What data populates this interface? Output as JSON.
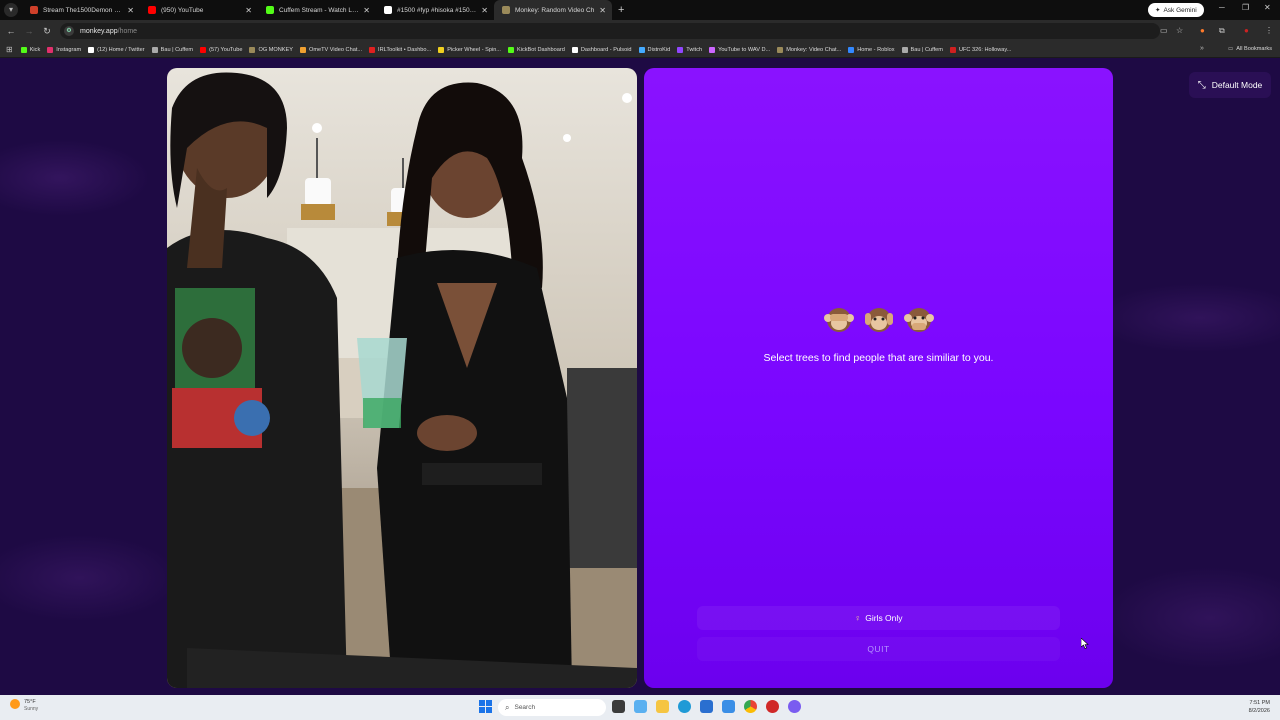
{
  "browser": {
    "tabs": [
      {
        "title": "Stream The1500Demon music",
        "fav": "#d0402a"
      },
      {
        "title": "(950) YouTube",
        "fav": "#ff0000"
      },
      {
        "title": "Cuffem Stream - Watch Live on",
        "fav": "#53fc18"
      },
      {
        "title": "#1500 #fyp #hisoka #1500dem",
        "fav": "#ffffff"
      },
      {
        "title": "Monkey: Random Video Ch",
        "fav": "#9a8a5a",
        "active": true
      }
    ],
    "new_tab": "+",
    "ask_gemini": "Ask Gemini",
    "url_host": "monkey.app",
    "url_path": "/home",
    "bookmarks": [
      {
        "label": "Kick",
        "color": "#53fc18"
      },
      {
        "label": "Instagram",
        "color": "#e1306c"
      },
      {
        "label": "(12) Home / Twitter",
        "color": "#ffffff"
      },
      {
        "label": "Bau | Cuffem",
        "color": "#aaaaaa"
      },
      {
        "label": "(57) YouTube",
        "color": "#ff0000"
      },
      {
        "label": "OG MONKEY",
        "color": "#9a8a5a"
      },
      {
        "label": "OmeTV Video Chat...",
        "color": "#f0a030"
      },
      {
        "label": "IRLToolkit • Dashbo...",
        "color": "#e02020"
      },
      {
        "label": "Picker Wheel - Spin...",
        "color": "#f0d020"
      },
      {
        "label": "KickBot Dashboard",
        "color": "#53fc18"
      },
      {
        "label": "Dashboard - Pulsoid",
        "color": "#ffffff"
      },
      {
        "label": "DistroKid",
        "color": "#44aaff"
      },
      {
        "label": "Twitch",
        "color": "#9146ff"
      },
      {
        "label": "YouTube to WAV D...",
        "color": "#cc66ff"
      },
      {
        "label": "Monkey: Video Chat...",
        "color": "#9a8a5a"
      },
      {
        "label": "Home - Roblox",
        "color": "#3388ff"
      },
      {
        "label": "Bau | Cuffem",
        "color": "#aaaaaa"
      },
      {
        "label": "UFC 326: Holloway...",
        "color": "#d02020"
      }
    ],
    "all_bookmarks": "All Bookmarks"
  },
  "page": {
    "tagline": "Select trees to find people that are similiar to you.",
    "filter_label": "Girls Only",
    "quit_label": "QUIT",
    "mode_label": "Default Mode",
    "accent_color": "#7a06ff"
  },
  "taskbar": {
    "temperature": "75°F",
    "condition": "Sunny",
    "search_placeholder": "Search",
    "time": "7:51 PM",
    "date": "8/2/2026"
  }
}
